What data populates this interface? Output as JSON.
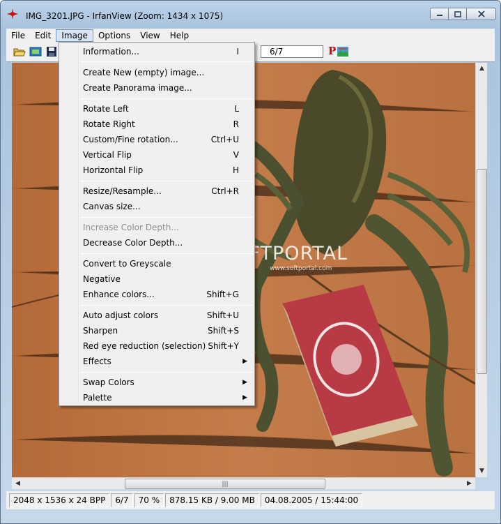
{
  "window": {
    "title": "IMG_3201.JPG - IrfanView (Zoom: 1434 x 1075)"
  },
  "menubar": {
    "items": [
      "File",
      "Edit",
      "Image",
      "Options",
      "View",
      "Help"
    ],
    "active": "Image"
  },
  "toolbar": {
    "page_field": "6/7",
    "logo_letter": "P"
  },
  "image_menu": {
    "items": [
      {
        "label": "Information...",
        "shortcut": "I",
        "submenu": false,
        "disabled": false
      },
      {
        "label": "Create New (empty) image...",
        "shortcut": "",
        "submenu": false,
        "disabled": false
      },
      {
        "label": "Create Panorama image...",
        "shortcut": "",
        "submenu": false,
        "disabled": false
      },
      {
        "label": "Rotate Left",
        "shortcut": "L",
        "submenu": false,
        "disabled": false
      },
      {
        "label": "Rotate Right",
        "shortcut": "R",
        "submenu": false,
        "disabled": false
      },
      {
        "label": "Custom/Fine rotation...",
        "shortcut": "Ctrl+U",
        "submenu": false,
        "disabled": false
      },
      {
        "label": "Vertical Flip",
        "shortcut": "V",
        "submenu": false,
        "disabled": false
      },
      {
        "label": "Horizontal Flip",
        "shortcut": "H",
        "submenu": false,
        "disabled": false
      },
      {
        "label": "Resize/Resample...",
        "shortcut": "Ctrl+R",
        "submenu": false,
        "disabled": false
      },
      {
        "label": "Canvas size...",
        "shortcut": "",
        "submenu": false,
        "disabled": false
      },
      {
        "label": "Increase Color Depth...",
        "shortcut": "",
        "submenu": false,
        "disabled": true
      },
      {
        "label": "Decrease Color Depth...",
        "shortcut": "",
        "submenu": false,
        "disabled": false
      },
      {
        "label": "Convert to Greyscale",
        "shortcut": "",
        "submenu": false,
        "disabled": false
      },
      {
        "label": "Negative",
        "shortcut": "",
        "submenu": false,
        "disabled": false
      },
      {
        "label": "Enhance colors...",
        "shortcut": "Shift+G",
        "submenu": false,
        "disabled": false
      },
      {
        "label": "Auto adjust colors",
        "shortcut": "Shift+U",
        "submenu": false,
        "disabled": false
      },
      {
        "label": "Sharpen",
        "shortcut": "Shift+S",
        "submenu": false,
        "disabled": false
      },
      {
        "label": "Red eye reduction (selection)",
        "shortcut": "Shift+Y",
        "submenu": false,
        "disabled": false
      },
      {
        "label": "Effects",
        "shortcut": "",
        "submenu": true,
        "disabled": false
      },
      {
        "label": "Swap Colors",
        "shortcut": "",
        "submenu": true,
        "disabled": false
      },
      {
        "label": "Palette",
        "shortcut": "",
        "submenu": true,
        "disabled": false
      }
    ]
  },
  "watermark": {
    "text": "SOFTPORTAL",
    "sub": "www.softportal.com"
  },
  "statusbar": {
    "dimensions": "2048 x 1536 x 24 BPP",
    "index": "6/7",
    "zoom": "70 %",
    "size": "878.15 KB / 9.00 MB",
    "datetime": "04.08.2005 / 15:44:00"
  },
  "colors": {
    "accent": "#d7e5f5",
    "logo_red": "#d10000"
  }
}
